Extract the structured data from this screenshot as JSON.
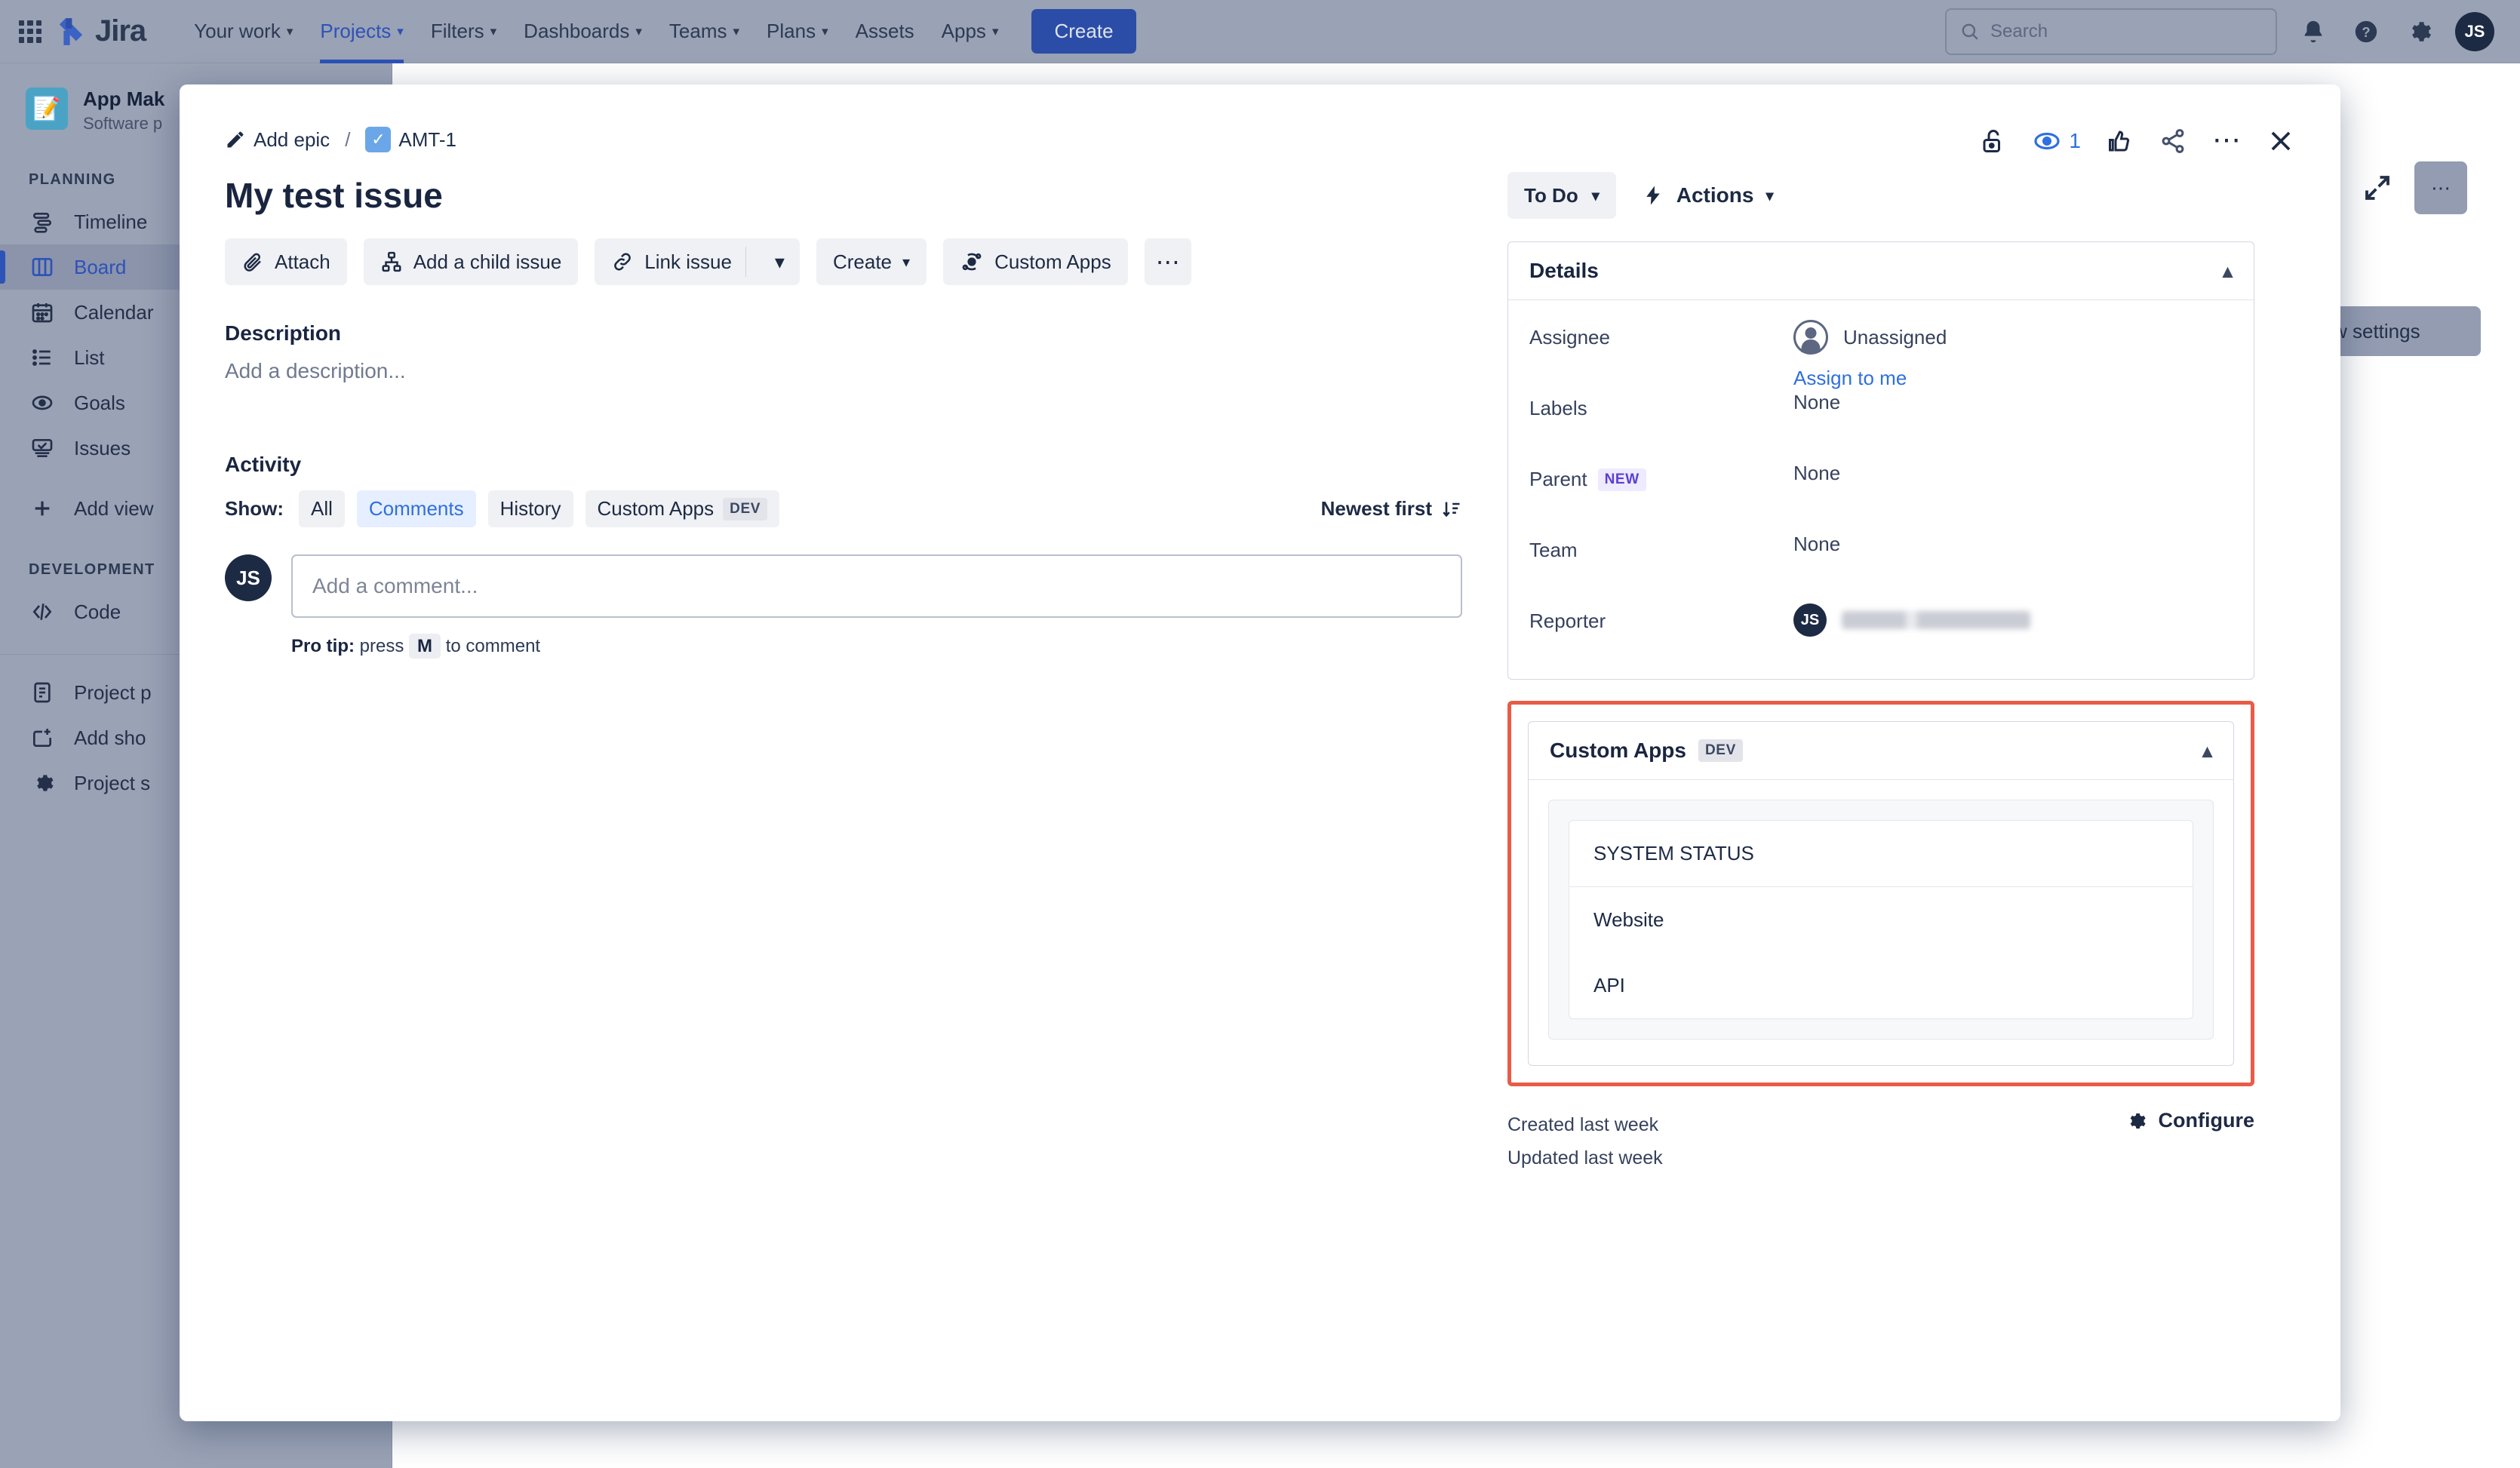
{
  "topnav": {
    "apps_grid_icon": "grid-icon",
    "logo_text": "Jira",
    "items": [
      {
        "label": "Your work",
        "caret": "⌄",
        "active": false
      },
      {
        "label": "Projects",
        "caret": "⌄",
        "active": true
      },
      {
        "label": "Filters",
        "caret": "⌄",
        "active": false
      },
      {
        "label": "Dashboards",
        "caret": "⌄",
        "active": false
      },
      {
        "label": "Teams",
        "caret": "⌄",
        "active": false
      },
      {
        "label": "Plans",
        "caret": "⌄",
        "active": false
      },
      {
        "label": "Assets",
        "caret": "",
        "active": false
      },
      {
        "label": "Apps",
        "caret": "⌄",
        "active": false
      }
    ],
    "create_label": "Create",
    "search_placeholder": "Search",
    "icons": [
      "notifications-bell-icon",
      "help-icon",
      "settings-gear-icon"
    ],
    "user_initials": "JS"
  },
  "sidebar": {
    "project_name": "App Mak",
    "project_type": "Software p",
    "planning_label": "PLANNING",
    "planning_items": [
      {
        "label": "Timeline",
        "icon": "timeline-icon",
        "selected": false
      },
      {
        "label": "Board",
        "icon": "board-icon",
        "selected": true
      },
      {
        "label": "Calendar",
        "icon": "calendar-icon",
        "selected": false
      },
      {
        "label": "List",
        "icon": "list-icon",
        "selected": false
      },
      {
        "label": "Goals",
        "icon": "goals-icon",
        "selected": false
      },
      {
        "label": "Issues",
        "icon": "issues-icon",
        "selected": false
      },
      {
        "label": "Add view",
        "icon": "plus-icon",
        "selected": false
      }
    ],
    "development_label": "DEVELOPMENT",
    "development_items": [
      {
        "label": "Code",
        "icon": "code-icon",
        "selected": false
      }
    ],
    "footer_items": [
      {
        "label": "Project p",
        "icon": "project-pages-icon"
      },
      {
        "label": "Add sho",
        "icon": "add-shortcut-icon"
      },
      {
        "label": "Project s",
        "icon": "gear-icon"
      }
    ]
  },
  "board_backdrop": {
    "view_settings_label": "w settings",
    "expand_icon": "expand-icon",
    "more_icon": "more-horizontal-icon"
  },
  "modal": {
    "breadcrumb": {
      "add_epic_label": "Add epic",
      "add_epic_icon": "pencil-icon",
      "separator": "/",
      "issue_key": "AMT-1",
      "issue_type_icon": "task-checkbox-icon"
    },
    "header_actions": {
      "lock_icon": "unlock-icon",
      "watch_icon": "eye-icon",
      "watch_count": "1",
      "like_icon": "thumbs-up-icon",
      "share_icon": "share-icon",
      "more_icon": "more-horizontal-icon",
      "close_icon": "close-icon"
    },
    "title": "My test issue",
    "action_buttons": [
      {
        "label": "Attach",
        "icon": "paperclip-icon",
        "split": false
      },
      {
        "label": "Add a child issue",
        "icon": "child-issue-icon",
        "split": false
      },
      {
        "label": "Link issue",
        "icon": "link-icon",
        "split": true
      },
      {
        "label": "Create",
        "icon": "",
        "split": false,
        "caret": true
      },
      {
        "label": "Custom Apps",
        "icon": "custom-apps-icon",
        "split": false
      }
    ],
    "more_button_icon": "more-horizontal-icon",
    "description": {
      "heading": "Description",
      "placeholder": "Add a description..."
    },
    "activity": {
      "heading": "Activity",
      "show_label": "Show:",
      "tabs": [
        {
          "label": "All",
          "active": false,
          "tag": ""
        },
        {
          "label": "Comments",
          "active": true,
          "tag": ""
        },
        {
          "label": "History",
          "active": false,
          "tag": ""
        },
        {
          "label": "Custom Apps",
          "active": false,
          "tag": "DEV"
        }
      ],
      "sort_label": "Newest first",
      "sort_icon": "sort-descending-icon",
      "comment_avatar_initials": "JS",
      "comment_placeholder": "Add a comment...",
      "protip_prefix": "Pro tip:",
      "protip_mid": "press",
      "protip_key": "M",
      "protip_suffix": "to comment"
    },
    "status": {
      "value": "To Do",
      "caret": "⌄",
      "actions_label": "Actions",
      "actions_icon": "lightning-icon",
      "actions_caret": "⌄"
    },
    "details": {
      "heading": "Details",
      "collapse_icon": "chevron-up-icon",
      "fields": [
        {
          "name": "Assignee",
          "value": "Unassigned",
          "tag": "",
          "avatar": "unassigned-avatar",
          "link": "Assign to me"
        },
        {
          "name": "Labels",
          "value": "None",
          "tag": "",
          "avatar": "",
          "link": ""
        },
        {
          "name": "Parent",
          "value": "None",
          "tag": "NEW",
          "avatar": "",
          "link": ""
        },
        {
          "name": "Team",
          "value": "None",
          "tag": "",
          "avatar": "",
          "link": ""
        },
        {
          "name": "Reporter",
          "value": "",
          "tag": "",
          "avatar": "JS",
          "link": "",
          "redacted": true
        }
      ]
    },
    "custom_apps_panel": {
      "heading": "Custom Apps",
      "tag": "DEV",
      "collapse_icon": "chevron-up-icon",
      "table_header": "SYSTEM STATUS",
      "rows": [
        "Website",
        "API"
      ],
      "highlight_color": "#e85c47"
    },
    "footer": {
      "created": "Created last week",
      "updated": "Updated last week",
      "configure_label": "Configure",
      "configure_icon": "gear-icon"
    }
  },
  "colors": {
    "brand_blue": "#2d52b8",
    "link_blue": "#2f6fe0",
    "highlight_red": "#e85c47",
    "dim_bg": "#9aa2b5"
  }
}
